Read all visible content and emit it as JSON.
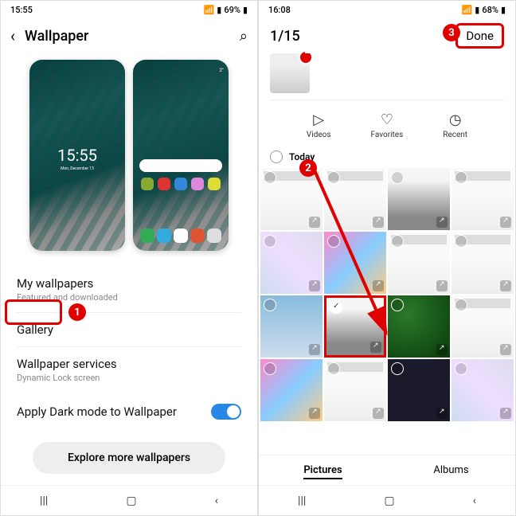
{
  "screen1": {
    "status": {
      "time": "15:55",
      "battery": "69%"
    },
    "header": {
      "title": "Wallpaper"
    },
    "preview": {
      "lock_time": "15:55",
      "lock_date": "Mon, December 13",
      "home_clock": "2°"
    },
    "menu": {
      "my_wallpapers": {
        "title": "My wallpapers",
        "sub": "Featured and downloaded"
      },
      "gallery": {
        "title": "Gallery"
      },
      "services": {
        "title": "Wallpaper services",
        "sub": "Dynamic Lock screen"
      },
      "dark_mode": {
        "title": "Apply Dark mode to Wallpaper"
      },
      "explore": "Explore more wallpapers"
    }
  },
  "screen2": {
    "status": {
      "time": "16:08",
      "battery": "68%"
    },
    "header": {
      "counter": "1/15",
      "done": "Done"
    },
    "filters": {
      "videos": "Videos",
      "favorites": "Favorites",
      "recent": "Recent"
    },
    "section": "Today",
    "tabs": {
      "pictures": "Pictures",
      "albums": "Albums"
    }
  },
  "annotations": {
    "n1": "1",
    "n2": "2",
    "n3": "3"
  }
}
